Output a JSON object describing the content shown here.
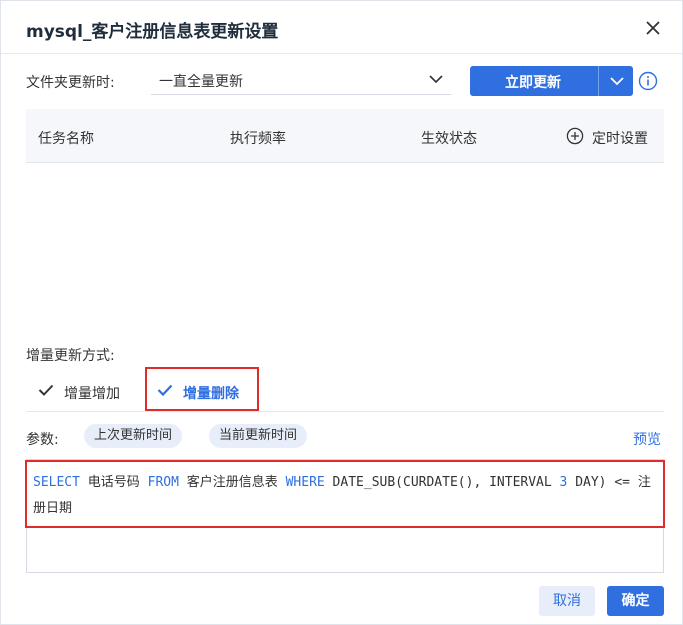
{
  "dialog": {
    "title": "mysql_客户注册信息表更新设置"
  },
  "folder_update": {
    "label": "文件夹更新时:",
    "selected": "一直全量更新",
    "button_label": "立即更新"
  },
  "table": {
    "columns": [
      "任务名称",
      "执行频率",
      "生效状态"
    ],
    "add_schedule_label": "定时设置"
  },
  "incremental": {
    "label": "增量更新方式:",
    "tabs": [
      {
        "label": "增量增加",
        "active": false
      },
      {
        "label": "增量删除",
        "active": true
      }
    ]
  },
  "params": {
    "label": "参数:",
    "chips": [
      "上次更新时间",
      "当前更新时间"
    ],
    "preview_label": "预览"
  },
  "sql_editor": {
    "segments": [
      {
        "type": "keyword",
        "text": "SELECT"
      },
      {
        "type": "text",
        "text": " 电话号码 "
      },
      {
        "type": "keyword",
        "text": "FROM"
      },
      {
        "type": "text",
        "text": " 客户注册信息表 "
      },
      {
        "type": "keyword",
        "text": "WHERE"
      },
      {
        "type": "text",
        "text": " DATE_SUB(CURDATE(), INTERVAL "
      },
      {
        "type": "number",
        "text": "3"
      },
      {
        "type": "text",
        "text": " DAY) <= 注册日期"
      }
    ]
  },
  "footer": {
    "cancel_label": "取消",
    "ok_label": "确定"
  },
  "colors": {
    "accent": "#2f6fe0",
    "highlight_border": "#e02b2b",
    "chip_bg": "#e7eefa"
  }
}
